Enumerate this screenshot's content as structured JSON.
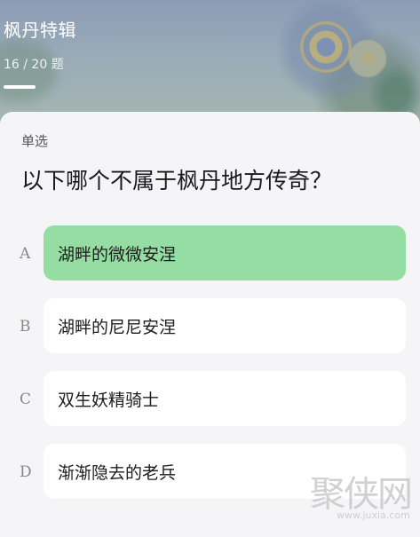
{
  "header": {
    "title": "枫丹特辑",
    "progress_text": "16 / 20 题",
    "progress_fraction": 0.8
  },
  "question": {
    "type_label": "单选",
    "text": "以下哪个不属于枫丹地方传奇？"
  },
  "options": [
    {
      "letter": "A",
      "text": "湖畔的微微安涅",
      "selected": true
    },
    {
      "letter": "B",
      "text": "湖畔的尼尼安涅",
      "selected": false
    },
    {
      "letter": "C",
      "text": "双生妖精骑士",
      "selected": false
    },
    {
      "letter": "D",
      "text": "渐渐隐去的老兵",
      "selected": false
    }
  ],
  "colors": {
    "selected_option": "#95dda3",
    "option_background": "#ffffff",
    "card_background": "#f5f5f7"
  },
  "watermark": {
    "text": "聚侠网",
    "url": "www.juxia.com"
  }
}
